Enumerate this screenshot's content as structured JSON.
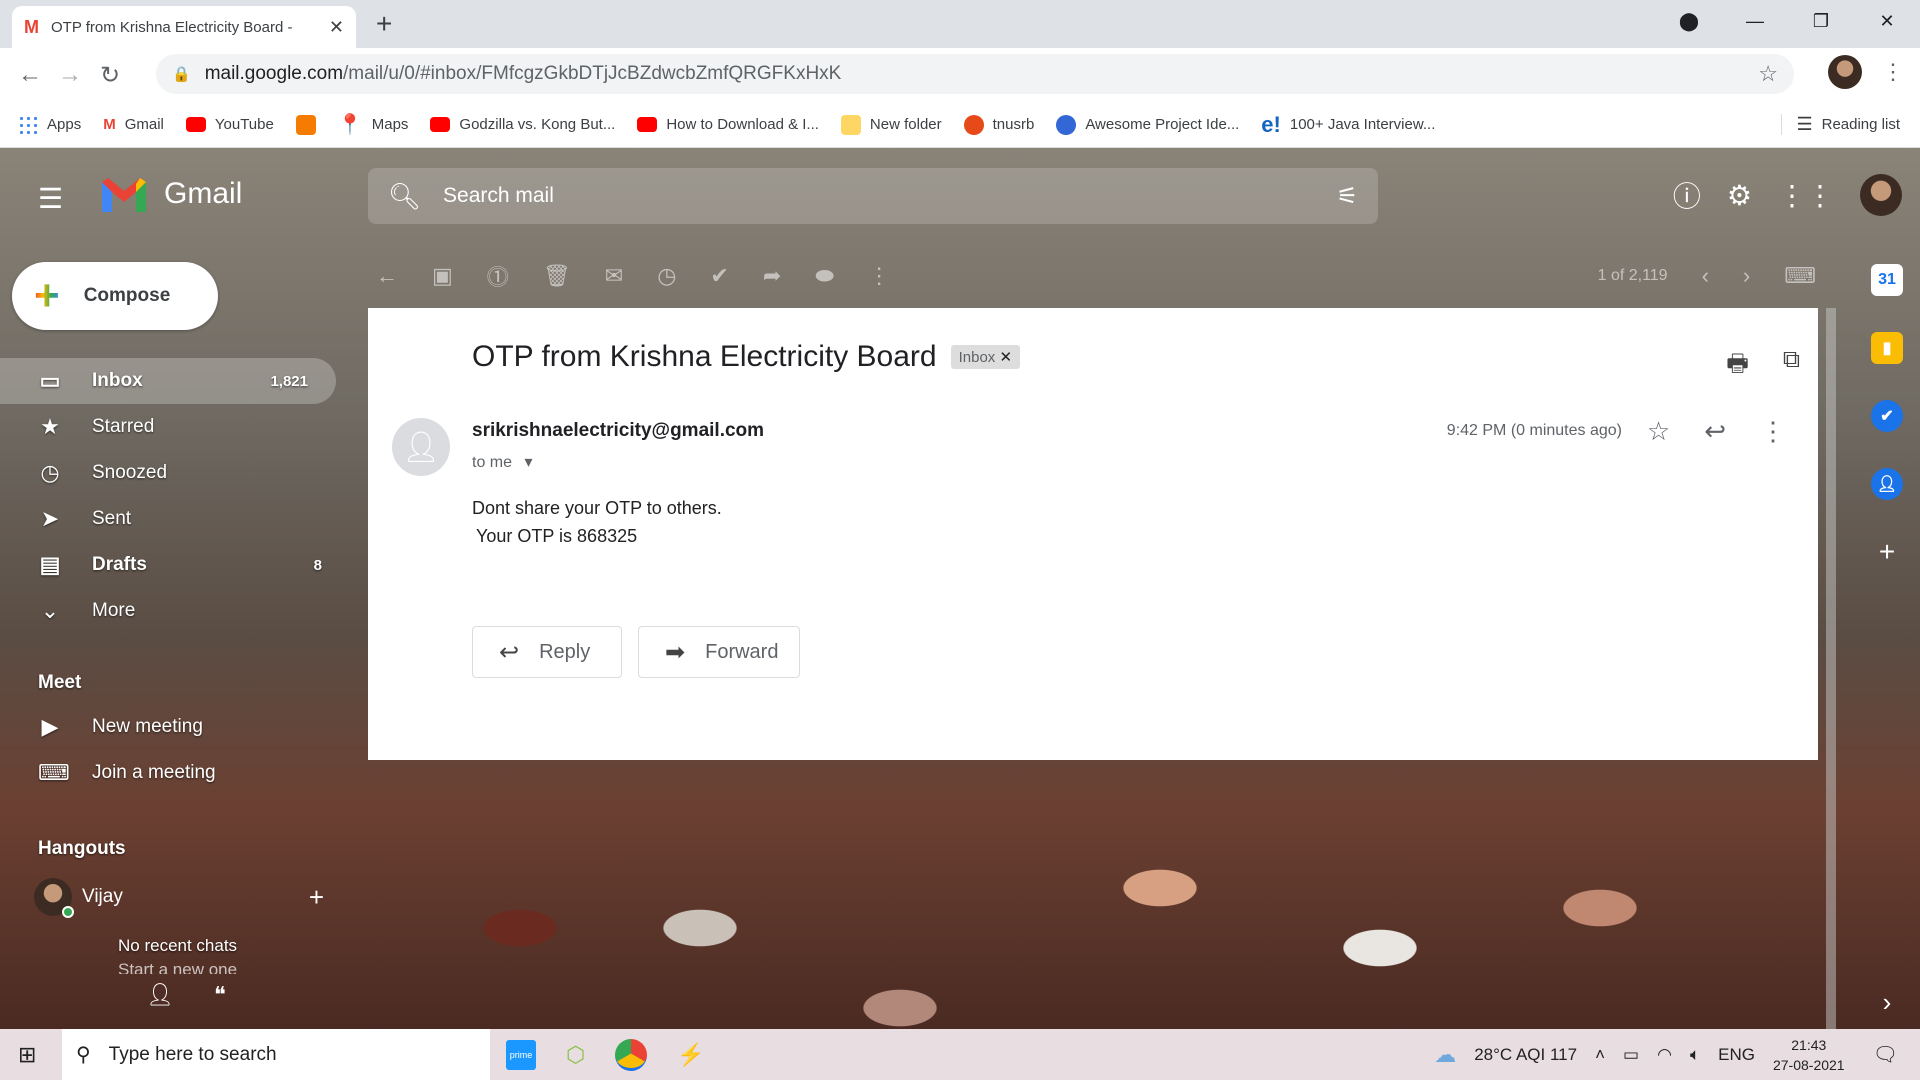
{
  "browser": {
    "tab_title": "OTP from Krishna Electricity Board -",
    "url_host": "mail.google.com",
    "url_path": "/mail/u/0/#inbox/FMfcgzGkbDTjJcBZdwcbZmfQRGFKxHxK",
    "bookmarks": [
      {
        "label": "Apps",
        "color": "#4285f4"
      },
      {
        "label": "Gmail",
        "color": "#ea4335"
      },
      {
        "label": "YouTube",
        "color": "#ff0000"
      },
      {
        "label": "",
        "color": "#f57c00"
      },
      {
        "label": "Maps",
        "color": "#34a853"
      },
      {
        "label": "Godzilla vs. Kong But...",
        "color": "#ff0000"
      },
      {
        "label": "How to Download & I...",
        "color": "#ff0000"
      },
      {
        "label": "New folder",
        "color": "#fbc02d"
      },
      {
        "label": "tnusrb",
        "color": "#e64a19"
      },
      {
        "label": "Awesome Project Ide...",
        "color": "#3367d6"
      },
      {
        "label": "100+ Java Interview...",
        "color": "#1565c0"
      }
    ],
    "reading_list": "Reading list"
  },
  "gmail": {
    "logo_text": "Gmail",
    "search_placeholder": "Search mail",
    "compose_label": "Compose",
    "nav": [
      {
        "label": "Inbox",
        "count": "1,821",
        "icon": "inbox-icon",
        "active": true
      },
      {
        "label": "Starred",
        "count": "",
        "icon": "star-icon"
      },
      {
        "label": "Snoozed",
        "count": "",
        "icon": "clock-icon"
      },
      {
        "label": "Sent",
        "count": "",
        "icon": "send-icon"
      },
      {
        "label": "Drafts",
        "count": "8",
        "icon": "draft-icon"
      },
      {
        "label": "More",
        "count": "",
        "icon": "chevron-down-icon"
      }
    ],
    "meet": {
      "title": "Meet",
      "items": [
        "New meeting",
        "Join a meeting"
      ]
    },
    "hangouts": {
      "title": "Hangouts",
      "user": "Vijay",
      "no_chats": "No recent chats",
      "start_new": "Start a new one"
    },
    "pagination": "1 of 2,119"
  },
  "message": {
    "subject": "OTP from Krishna Electricity Board",
    "label_chip": "Inbox",
    "sender": "srikrishnaelectricity@gmail.com",
    "to": "to me",
    "time": "9:42 PM (0 minutes ago)",
    "body_line1": "Dont share your OTP to others.",
    "body_line2": "Your OTP is 868325",
    "reply_label": "Reply",
    "forward_label": "Forward"
  },
  "taskbar": {
    "search_placeholder": "Type here to search",
    "weather": "28°C  AQI 117",
    "lang": "ENG",
    "time": "21:43",
    "date": "27-08-2021"
  }
}
